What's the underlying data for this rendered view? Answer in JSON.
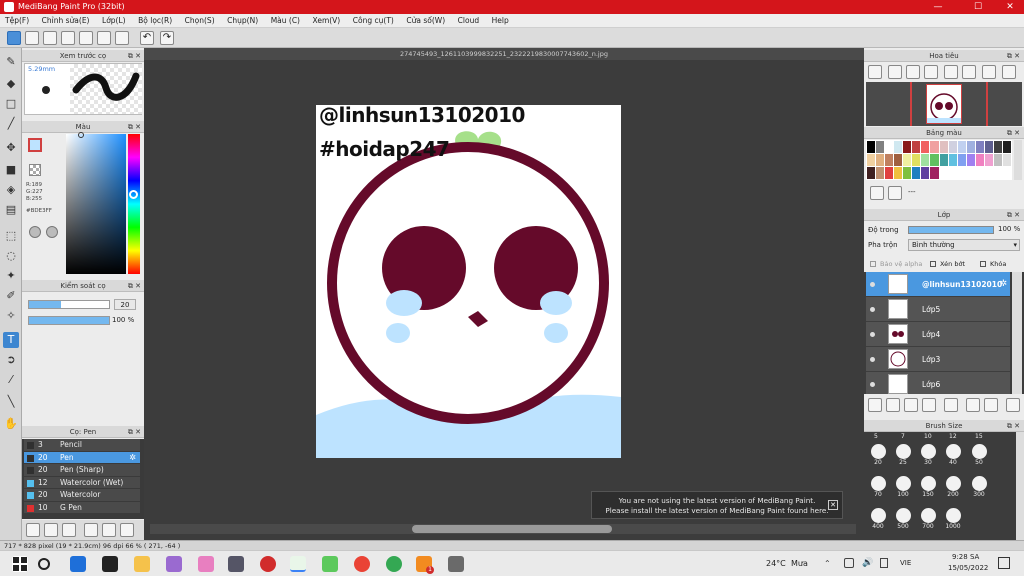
{
  "window": {
    "title": "MediBang Paint Pro (32bit)",
    "minimize": "—",
    "maximize": "☐",
    "close": "✕"
  },
  "menu": [
    "Tệp(F)",
    "Chỉnh sửa(E)",
    "Lớp(L)",
    "Bộ lọc(R)",
    "Chọn(S)",
    "Chụp(N)",
    "Màu (C)",
    "Xem(V)",
    "Công cụ(T)",
    "Cửa số(W)",
    "Cloud",
    "Help"
  ],
  "document": {
    "filename": "274745493_1261103999832251_2322219830007743602_n.jpg"
  },
  "canvas_text": {
    "line1": "@linhsun13102010",
    "line2": "#hoidap247"
  },
  "panels": {
    "brush_preview": {
      "title": "Xem trước cọ",
      "size": "5.29mm"
    },
    "color": {
      "title": "Màu",
      "r": "R:189",
      "g": "G:227",
      "b": "B:255",
      "hex": "#BDE3FF"
    },
    "brush_control": {
      "title": "Kiểm soát cọ",
      "size_value": "20",
      "opacity_value": "100 %"
    },
    "brush_list": {
      "title": "Cọ: Pen",
      "items": [
        {
          "size": "3",
          "name": "Pencil",
          "color": "#303030"
        },
        {
          "size": "20",
          "name": "Pen",
          "color": "#303030"
        },
        {
          "size": "20",
          "name": "Pen (Sharp)",
          "color": "#303030"
        },
        {
          "size": "12",
          "name": "Watercolor (Wet)",
          "color": "#55c0ef"
        },
        {
          "size": "20",
          "name": "Watercolor",
          "color": "#55c0ef"
        },
        {
          "size": "10",
          "name": "G Pen",
          "color": "#e03030"
        }
      ]
    },
    "navigator": {
      "title": "Hoa tiêu"
    },
    "palette": {
      "title": "Bảng màu",
      "dashes": "---"
    },
    "layers": {
      "title": "Lớp",
      "opacity_label": "Độ trong",
      "opacity_value": "100 %",
      "blend_label": "Pha trộn",
      "blend_value": "Bình thường",
      "protect_alpha": "Bảo vệ alpha",
      "clipping": "Xén bớt",
      "lock": "Khóa",
      "items": [
        {
          "name": "@linhsun13102010"
        },
        {
          "name": "Lớp5"
        },
        {
          "name": "Lớp4"
        },
        {
          "name": "Lớp3"
        },
        {
          "name": "Lớp6"
        }
      ]
    },
    "brush_size": {
      "title": "Brush Size",
      "header_sizes": [
        "5",
        "7",
        "10",
        "12",
        "15"
      ],
      "rows": [
        [
          "20",
          "25",
          "30",
          "40",
          "50"
        ],
        [
          "70",
          "100",
          "150",
          "200",
          "300"
        ],
        [
          "400",
          "500",
          "700",
          "1000"
        ]
      ]
    }
  },
  "notification": {
    "line1": "You are not using the latest version of MediBang Paint.",
    "line2": "Please install the latest version of MediBang Paint found here."
  },
  "status": {
    "text": "717 * 828 pixel  (19 * 21.9cm)  96 dpi  66 %  ( 271, -64 )"
  },
  "taskbar": {
    "weather": "24°C",
    "condition": "Mưa",
    "language": "VIE",
    "time": "9:28 SA",
    "date": "15/05/2022",
    "notif_count": "1"
  }
}
